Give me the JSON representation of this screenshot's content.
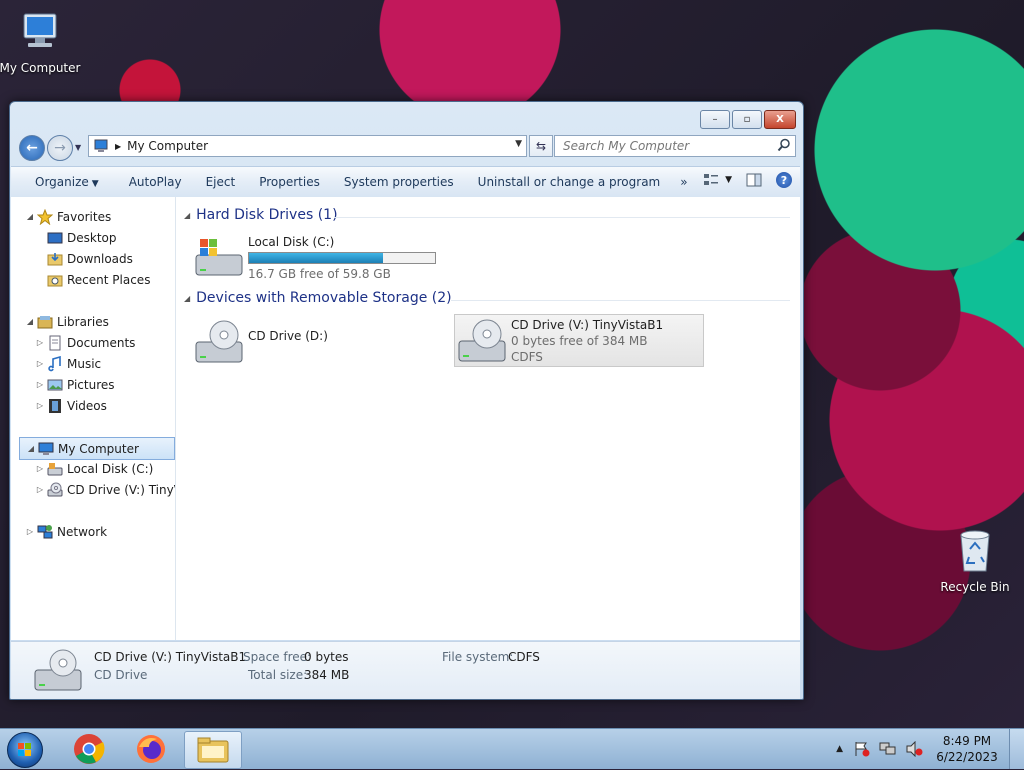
{
  "desktop": {
    "icons": [
      {
        "label": "My Computer",
        "icon": "computer-icon"
      },
      {
        "label": "Recycle Bin",
        "icon": "recycle-bin-icon"
      }
    ]
  },
  "window": {
    "caption_buttons": {
      "minimize": "–",
      "maximize": "▫",
      "close": "X"
    },
    "address": {
      "path": "My Computer"
    },
    "search": {
      "placeholder": "Search My Computer"
    },
    "toolbar": {
      "organize": "Organize",
      "autoplay": "AutoPlay",
      "eject": "Eject",
      "properties": "Properties",
      "system_properties": "System properties",
      "uninstall": "Uninstall or change a program",
      "more": "»",
      "help": "?"
    },
    "nav": {
      "favorites": "Favorites",
      "desktop": "Desktop",
      "downloads": "Downloads",
      "recent_places": "Recent Places",
      "libraries": "Libraries",
      "documents": "Documents",
      "music": "Music",
      "pictures": "Pictures",
      "videos": "Videos",
      "my_computer": "My Computer",
      "local_disk": "Local Disk (C:)",
      "cd_drive": "CD Drive (V:) TinyVis",
      "network": "Network"
    },
    "groups": {
      "hdd": {
        "title": "Hard Disk Drives (1)",
        "drives": [
          {
            "name": "Local Disk (C:)",
            "free": "16.7 GB free of 59.8 GB",
            "used_fraction": 0.72
          }
        ]
      },
      "removable": {
        "title": "Devices with Removable Storage (2)",
        "drives": [
          {
            "name": "CD Drive (D:)"
          },
          {
            "name": "CD Drive (V:) TinyVistaB1",
            "free": "0 bytes free of 384 MB",
            "fs": "CDFS"
          }
        ]
      }
    },
    "details": {
      "name": "CD Drive (V:) TinyVistaB1",
      "type": "CD Drive",
      "space_free_label": "Space free:",
      "space_free": "0 bytes",
      "total_size_label": "Total size:",
      "total_size": "384 MB",
      "fs_label": "File system:",
      "fs": "CDFS"
    }
  },
  "taskbar": {
    "time": "8:49 PM",
    "date": "6/22/2023",
    "tray_expand": "▲"
  }
}
